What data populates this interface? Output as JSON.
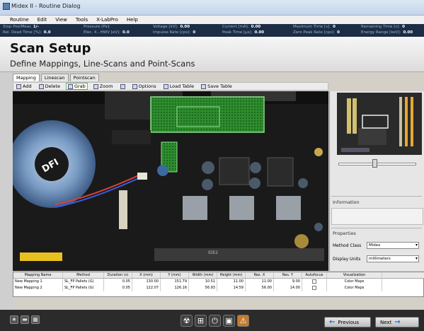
{
  "window": {
    "title": "Midex II - Routine Dialog"
  },
  "menu": [
    "Routine",
    "Edit",
    "View",
    "Tools",
    "X-LabPro",
    "Help"
  ],
  "readouts": [
    {
      "label": "Stop Pos/Meas",
      "value": "1/-"
    },
    {
      "label": "Pressure [Pa]:",
      "value": ""
    },
    {
      "label": "Voltage [kV]:",
      "value": "0.00"
    },
    {
      "label": "Current [mA]:",
      "value": "0.00"
    },
    {
      "label": "Maximum Time [s]:",
      "value": "0"
    },
    {
      "label": "Remaining Time [s]:",
      "value": "0"
    },
    {
      "label": "Rel. Dead Time [%]:",
      "value": "0.0"
    },
    {
      "label": "Elec. 4...HWV [eV]:",
      "value": "0.0"
    },
    {
      "label": "Impulse Rate [cps]:",
      "value": "0"
    },
    {
      "label": "Peak Time [µs]:",
      "value": "0.00"
    },
    {
      "label": "Zero Peak Rate [cps]:",
      "value": "0"
    },
    {
      "label": "Energy Range [keV]:",
      "value": "0.00"
    }
  ],
  "heading": {
    "title": "Scan Setup",
    "subtitle": "Define Mappings, Line-Scans and Point-Scans"
  },
  "tabs": [
    "Mapping",
    "Linescan",
    "Pointscan"
  ],
  "toolbar": [
    "Add",
    "Delete",
    "Grab",
    "Zoom",
    "Options",
    "Load Table",
    "Save Table"
  ],
  "board": {
    "chip_label": "DFI",
    "pcb_text": "IDE2"
  },
  "right_panel": {
    "information_label": "Information",
    "properties_label": "Properties",
    "method_class_label": "Method Class",
    "method_class_value": "Midex",
    "display_units_label": "Display Units",
    "display_units_value": "millimeters"
  },
  "table": {
    "headers": [
      "Mapping Name",
      "Method",
      "Duration (s)",
      "X (mm)",
      "Y (mm)",
      "Width (mm)",
      "Height (mm)",
      "Res. X",
      "Res. Y",
      "Autofocus",
      "Visualization"
    ],
    "rows": [
      [
        "New Mapping 1",
        "SL_FP Pallets (G)",
        "0.05",
        "130.00",
        "151.79",
        "10.51",
        "11.00",
        "11.00",
        "9.00",
        "",
        "Color Maps"
      ],
      [
        "New Mapping 2",
        "SL_FP Pallets (G)",
        "0.05",
        "122.07",
        "126.16",
        "56.93",
        "14.59",
        "56.00",
        "14.00",
        "",
        "Color Maps"
      ]
    ]
  },
  "nav": {
    "previous": "Previous",
    "next": "Next"
  },
  "colors": {
    "accent": "#1c2d45",
    "highlight": "#3fae3f",
    "warning": "#c67b2b"
  }
}
